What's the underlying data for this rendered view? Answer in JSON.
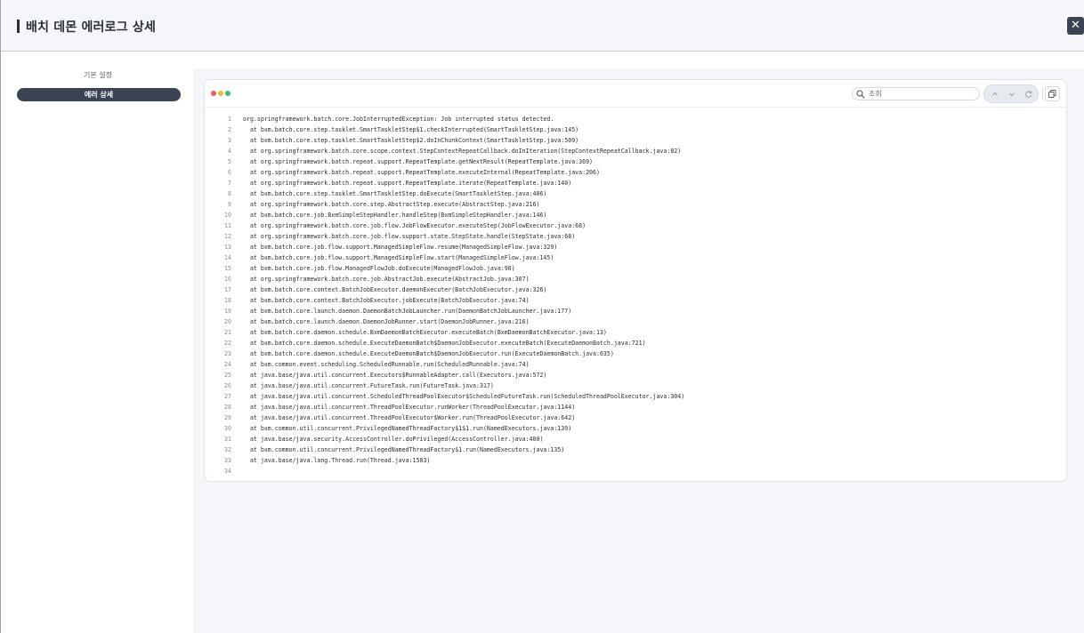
{
  "header": {
    "title": "배치 데몬 에러로그 상세",
    "close_label": "✕"
  },
  "sidebar": {
    "heading": "기본 설정",
    "active_item": "에러 상세"
  },
  "toolbar": {
    "search_placeholder": "조회"
  },
  "log_lines": [
    "org.springframework.batch.core.JobInterruptedException: Job interrupted status detected.",
    "  at bxm.batch.core.step.tasklet.SmartTaskletStep$1.checkInterrupted(SmartTaskletStep.java:145)",
    "  at bxm.batch.core.step.tasklet.SmartTaskletStep$2.doInChunkContext(SmartTaskletStep.java:509)",
    "  at org.springframework.batch.core.scope.context.StepContextRepeatCallback.doInIteration(StepContextRepeatCallback.java:82)",
    "  at org.springframework.batch.repeat.support.RepeatTemplate.getNextResult(RepeatTemplate.java:369)",
    "  at org.springframework.batch.repeat.support.RepeatTemplate.executeInternal(RepeatTemplate.java:206)",
    "  at org.springframework.batch.repeat.support.RepeatTemplate.iterate(RepeatTemplate.java:140)",
    "  at bxm.batch.core.step.tasklet.SmartTaskletStep.doExecute(SmartTaskletStep.java:406)",
    "  at org.springframework.batch.core.step.AbstractStep.execute(AbstractStep.java:216)",
    "  at bxm.batch.core.job.BxmSimpleStepHandler.handleStep(BxmSimpleStepHandler.java:146)",
    "  at org.springframework.batch.core.job.flow.JobFlowExecutor.executeStep(JobFlowExecutor.java:68)",
    "  at org.springframework.batch.core.job.flow.support.state.StepState.handle(StepState.java:68)",
    "  at bxm.batch.core.job.flow.support.ManagedSimpleFlow.resume(ManagedSimpleFlow.java:329)",
    "  at bxm.batch.core.job.flow.support.ManagedSimpleFlow.start(ManagedSimpleFlow.java:145)",
    "  at bxm.batch.core.job.flow.ManagedFlowJob.doExecute(ManagedFlowJob.java:98)",
    "  at org.springframework.batch.core.job.AbstractJob.execute(AbstractJob.java:307)",
    "  at bxm.batch.core.context.BatchJobExecutor.daemonExecuter(BatchJobExecutor.java:326)",
    "  at bxm.batch.core.context.BatchJobExecutor.jobExecute(BatchJobExecutor.java:74)",
    "  at bxm.batch.core.launch.daemon.DaemonBatchJobLauncher.run(DaemonBatchJobLauncher.java:177)",
    "  at bxm.batch.core.launch.daemon.DaemonJobRunner.start(DaemonJobRunner.java:216)",
    "  at bxm.batch.core.daemon.schedule.BxmDaemonBatchExecutor.executeBatch(BxmDaemonBatchExecutor.java:13)",
    "  at bxm.batch.core.daemon.schedule.ExecuteDaemonBatch$DaemonJobExecutor.executeBatch(ExecuteDaemonBatch.java:721)",
    "  at bxm.batch.core.daemon.schedule.ExecuteDaemonBatch$DaemonJobExecutor.run(ExecuteDaemonBatch.java:635)",
    "  at bxm.common.event.scheduling.ScheduledRunnable.run(ScheduledRunnable.java:74)",
    "  at java.base/java.util.concurrent.Executors$RunnableAdapter.call(Executors.java:572)",
    "  at java.base/java.util.concurrent.FutureTask.run(FutureTask.java:317)",
    "  at java.base/java.util.concurrent.ScheduledThreadPoolExecutor$ScheduledFutureTask.run(ScheduledThreadPoolExecutor.java:304)",
    "  at java.base/java.util.concurrent.ThreadPoolExecutor.runWorker(ThreadPoolExecutor.java:1144)",
    "  at java.base/java.util.concurrent.ThreadPoolExecutor$Worker.run(ThreadPoolExecutor.java:642)",
    "  at bxm.common.util.concurrent.PrivilegedNamedThreadFactory$1$1.run(NamedExecutors.java:139)",
    "  at java.base/java.security.AccessController.doPrivileged(AccessController.java:400)",
    "  at bxm.common.util.concurrent.PrivilegedNamedThreadFactory$1.run(NamedExecutors.java:135)",
    "  at java.base/java.lang.Thread.run(Thread.java:1583)",
    ""
  ]
}
